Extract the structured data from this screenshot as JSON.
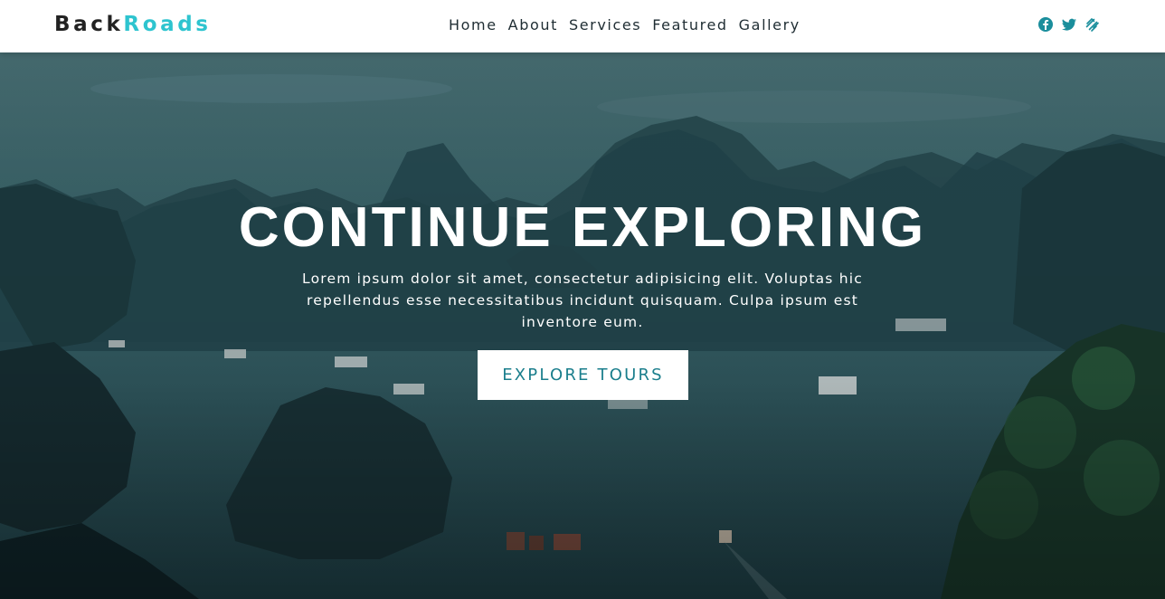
{
  "navbar": {
    "logo_part1": "Back",
    "logo_part2": "Roads",
    "links": [
      "Home",
      "About",
      "Services",
      "Featured",
      "Gallery"
    ],
    "social_icons": [
      "facebook-icon",
      "twitter-icon",
      "squarespace-icon"
    ],
    "accent_color": "#2ec4cf",
    "icon_color": "#1a8e9c"
  },
  "hero": {
    "title": "CONTINUE EXPLORING",
    "text": "Lorem ipsum dolor sit amet, consectetur adipisicing elit. Voluptas hic repellendus esse necessitatibus incidunt quisquam. Culpa ipsum est inventore eum.",
    "button_label": "EXPLORE TOURS",
    "button_text_color": "#1a7e8c"
  }
}
